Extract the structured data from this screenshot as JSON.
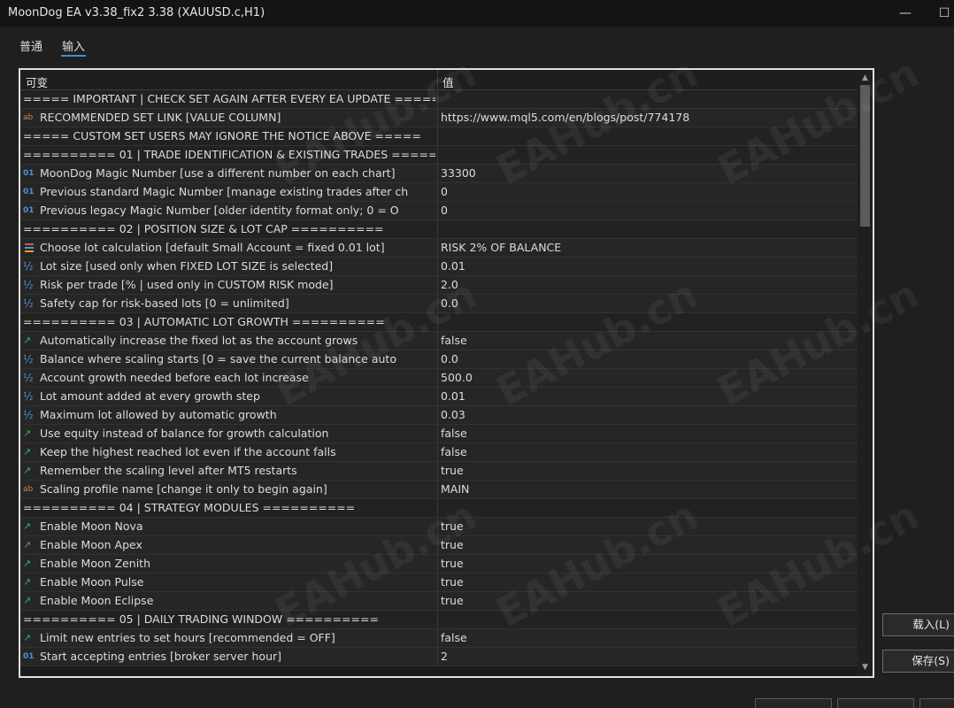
{
  "window": {
    "title": "MoonDog EA v3.38_fix2 3.38 (XAUUSD.c,H1)",
    "minimize_glyph": "—",
    "maximize_glyph": "☐"
  },
  "tabs": [
    {
      "label": "普通"
    },
    {
      "label": "输入"
    }
  ],
  "table": {
    "col_variable": "可变",
    "col_value": "值",
    "rows": [
      {
        "type": "section",
        "name": "===== IMPORTANT | CHECK SET AGAIN AFTER EVERY EA UPDATE =====",
        "value": ""
      },
      {
        "type": "string",
        "name": "RECOMMENDED SET LINK [VALUE COLUMN]",
        "value": "https://www.mql5.com/en/blogs/post/774178"
      },
      {
        "type": "section",
        "name": "===== CUSTOM SET USERS MAY IGNORE THE NOTICE ABOVE =====",
        "value": ""
      },
      {
        "type": "section",
        "name": "========== 01 | TRADE IDENTIFICATION & EXISTING TRADES ========",
        "value": ""
      },
      {
        "type": "int",
        "name": "MoonDog Magic Number [use a different number on each chart]",
        "value": "33300"
      },
      {
        "type": "int",
        "name": "Previous standard Magic Number [manage existing trades after ch",
        "value": "0"
      },
      {
        "type": "int",
        "name": "Previous legacy Magic Number [older identity format only; 0 = O",
        "value": "0"
      },
      {
        "type": "section",
        "name": "========== 02 | POSITION SIZE & LOT CAP ==========",
        "value": ""
      },
      {
        "type": "enum",
        "name": "Choose lot calculation [default Small Account = fixed 0.01 lot]",
        "value": "RISK 2% OF BALANCE"
      },
      {
        "type": "double",
        "name": "Lot size [used only when FIXED LOT SIZE is selected]",
        "value": "0.01"
      },
      {
        "type": "double",
        "name": "Risk per trade [% | used only in CUSTOM RISK mode]",
        "value": "2.0"
      },
      {
        "type": "double",
        "name": "Safety cap for risk-based lots [0 = unlimited]",
        "value": "0.0"
      },
      {
        "type": "section",
        "name": "========== 03 | AUTOMATIC LOT GROWTH ==========",
        "value": ""
      },
      {
        "type": "bool",
        "name": "Automatically increase the fixed lot as the account grows",
        "value": "false"
      },
      {
        "type": "double",
        "name": "Balance where scaling starts [0 = save the current balance auto",
        "value": "0.0"
      },
      {
        "type": "double",
        "name": "Account growth needed before each lot increase",
        "value": "500.0"
      },
      {
        "type": "double",
        "name": "Lot amount added at every growth step",
        "value": "0.01"
      },
      {
        "type": "double",
        "name": "Maximum lot allowed by automatic growth",
        "value": "0.03"
      },
      {
        "type": "bool",
        "name": "Use equity instead of balance for growth calculation",
        "value": "false"
      },
      {
        "type": "bool",
        "name": "Keep the highest reached lot even if the account falls",
        "value": "false"
      },
      {
        "type": "bool",
        "name": "Remember the scaling level after MT5 restarts",
        "value": "true"
      },
      {
        "type": "string",
        "name": "Scaling profile name [change it only to begin again]",
        "value": "MAIN"
      },
      {
        "type": "section",
        "name": "========== 04 | STRATEGY MODULES ==========",
        "value": ""
      },
      {
        "type": "bool",
        "name": "Enable Moon Nova",
        "value": "true"
      },
      {
        "type": "bool",
        "name": "Enable Moon Apex",
        "value": "true"
      },
      {
        "type": "bool",
        "name": "Enable Moon Zenith",
        "value": "true"
      },
      {
        "type": "bool",
        "name": "Enable Moon Pulse",
        "value": "true"
      },
      {
        "type": "bool",
        "name": "Enable Moon Eclipse",
        "value": "true"
      },
      {
        "type": "section",
        "name": "========== 05 | DAILY TRADING WINDOW ==========",
        "value": ""
      },
      {
        "type": "bool",
        "name": "Limit new entries to set hours [recommended = OFF]",
        "value": "false"
      },
      {
        "type": "int",
        "name": "Start accepting entries [broker server hour]",
        "value": "2"
      }
    ]
  },
  "icons": {
    "string": "ab",
    "int": "01",
    "double": "½",
    "bool": "↗",
    "enum": "list"
  },
  "buttons": {
    "load": "载入(L)",
    "save": "保存(S)"
  },
  "watermark": "EAHub.cn",
  "colors": {
    "accent": "#3b8fd6",
    "string_icon": "#c98a3a",
    "number_icon": "#4f92d8",
    "bool_icon": "#3ea66a"
  }
}
